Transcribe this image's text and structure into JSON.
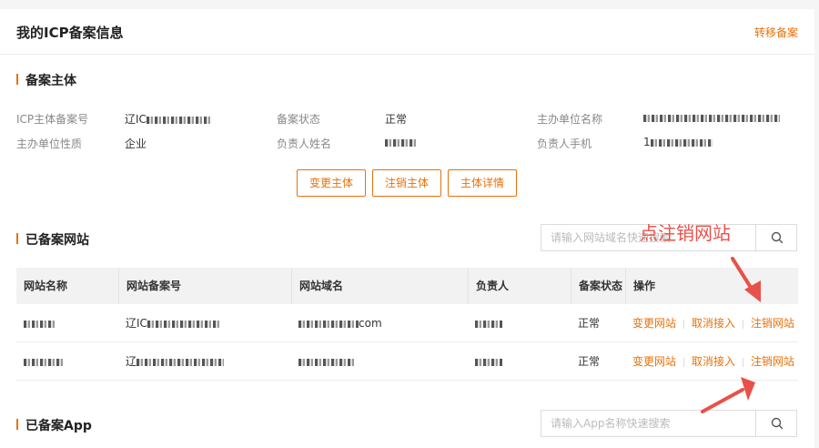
{
  "header": {
    "title": "我的ICP备案信息",
    "transfer_label": "转移备案"
  },
  "subject": {
    "section_title": "备案主体",
    "fields": {
      "icp_no_label": "ICP主体备案号",
      "icp_no_value": "辽IC",
      "status_label": "备案状态",
      "status_value": "正常",
      "org_name_label": "主办单位名称",
      "org_type_label": "主办单位性质",
      "org_type_value": "企业",
      "owner_label": "负责人姓名",
      "phone_label": "负责人手机",
      "phone_prefix": "1"
    },
    "buttons": [
      "变更主体",
      "注销主体",
      "主体详情"
    ]
  },
  "websites": {
    "section_title": "已备案网站",
    "search_placeholder": "请输入网站域名快速搜索",
    "columns": [
      "网站名称",
      "网站备案号",
      "网站域名",
      "负责人",
      "备案状态",
      "操作"
    ],
    "rows": [
      {
        "record_prefix": "辽IC",
        "domain_suffix": "com",
        "status": "正常"
      },
      {
        "record_prefix": "辽",
        "domain_suffix": "",
        "status": "正常"
      }
    ],
    "actions": {
      "change": "变更网站",
      "cancel": "取消接入",
      "delete": "注销网站"
    }
  },
  "apps": {
    "section_title": "已备案App",
    "search_placeholder": "请输入App名称快速搜索"
  },
  "annotation": {
    "text": "点注销网站",
    "color": "#e8514a"
  },
  "colors": {
    "accent": "#e8710a",
    "annotation": "#e8514a"
  },
  "icons": [
    "search-icon",
    "arrow-icon"
  ]
}
